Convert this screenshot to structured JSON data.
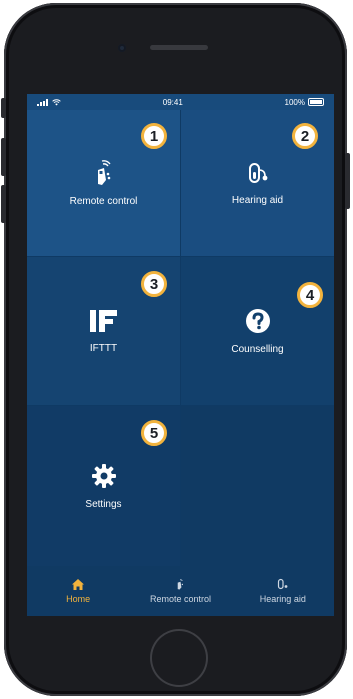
{
  "statusbar": {
    "time": "09:41",
    "battery": "100%"
  },
  "tiles": [
    {
      "label": "Remote control",
      "badge": "1",
      "icon": "remote-control-icon"
    },
    {
      "label": "Hearing aid",
      "badge": "2",
      "icon": "hearing-aid-icon"
    },
    {
      "label": "IFTTT",
      "badge": "3",
      "icon": "ifttt-icon"
    },
    {
      "label": "Counselling",
      "badge": "4",
      "icon": "question-icon"
    },
    {
      "label": "Settings",
      "badge": "5",
      "icon": "gear-icon"
    }
  ],
  "tabbar": [
    {
      "label": "Home",
      "icon": "home-icon",
      "active": true
    },
    {
      "label": "Remote control",
      "icon": "remote-control-icon",
      "active": false
    },
    {
      "label": "Hearing aid",
      "icon": "hearing-aid-icon",
      "active": false
    }
  ],
  "colors": {
    "accent": "#f2b33d",
    "screen_bg": "#0f3a64",
    "tile_light": "#1d5387"
  }
}
